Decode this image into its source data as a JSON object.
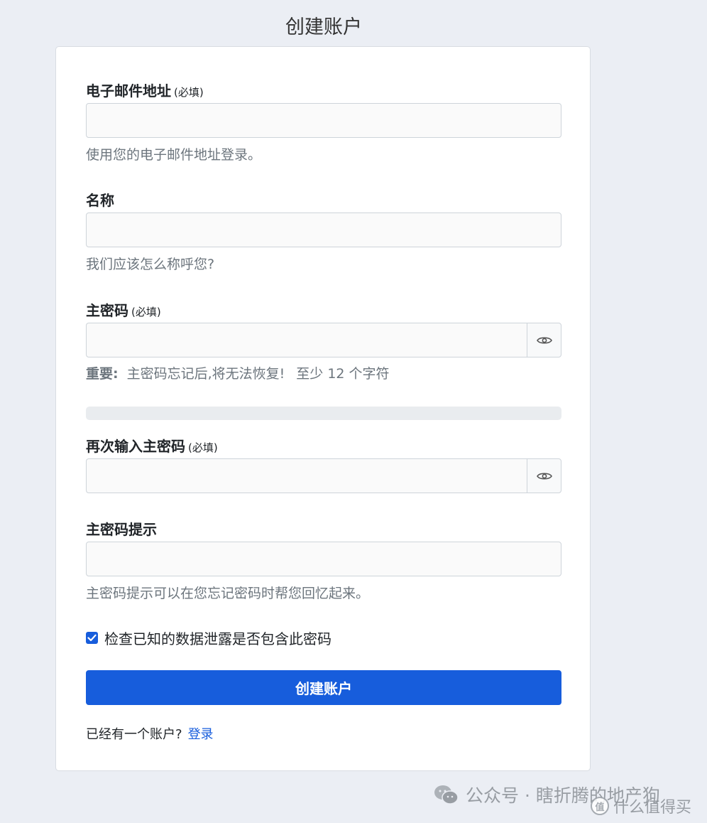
{
  "page": {
    "title": "创建账户"
  },
  "form": {
    "email": {
      "label": "电子邮件地址",
      "required": "(必填)",
      "value": "",
      "help": "使用您的电子邮件地址登录。"
    },
    "name": {
      "label": "名称",
      "value": "",
      "help": "我们应该怎么称呼您?"
    },
    "master_password": {
      "label": "主密码",
      "required": "(必填)",
      "value": "",
      "toggle_icon": "eye-icon",
      "help_important": "重要:",
      "help_warning": "主密码忘记后,将无法恢复!",
      "help_min": "至少 12 个字符",
      "strength": 0
    },
    "confirm_password": {
      "label": "再次输入主密码",
      "required": "(必填)",
      "value": "",
      "toggle_icon": "eye-icon"
    },
    "hint": {
      "label": "主密码提示",
      "value": "",
      "help": "主密码提示可以在您忘记密码时帮您回忆起来。"
    },
    "breach_check": {
      "label": "检查已知的数据泄露是否包含此密码",
      "checked": true
    },
    "submit_label": "创建账户",
    "login_prompt": "已经有一个账户?",
    "login_link": "登录"
  },
  "watermark": {
    "text": "公众号 · 瞎折腾的地产狗",
    "text2": "什么值得买",
    "badge": "值"
  },
  "colors": {
    "accent": "#175ddc",
    "background": "#ebeef4",
    "muted_text": "#6c757d"
  }
}
